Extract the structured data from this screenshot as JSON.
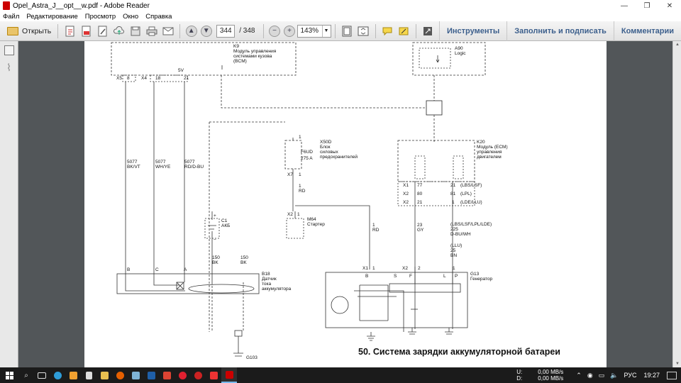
{
  "window": {
    "title": "Opel_Astra_J__opt__w.pdf - Adobe Reader",
    "controls": [
      "—",
      "❐",
      "✕"
    ]
  },
  "menu": [
    "Файл",
    "Редактирование",
    "Просмотр",
    "Окно",
    "Справка"
  ],
  "toolbar": {
    "open_label": "Открыть",
    "page_current": "344",
    "page_total": "/ 348",
    "zoom": "143%",
    "tools_label": "Инструменты",
    "fill_sign_label": "Заполнить и подписать",
    "comments_label": "Комментарии"
  },
  "diagram": {
    "k9": {
      "code": "K9",
      "line1": "Модуль управления",
      "line2": "системами кузова",
      "line3": "(BCM)"
    },
    "k9_pins": {
      "x5": "X5",
      "p8": "8",
      "x4": "X4",
      "p18": "18",
      "p21": "21",
      "v5": "5V"
    },
    "a90": {
      "code": "A90",
      "name": "Logic"
    },
    "x50d": {
      "code": "X50D",
      "line1": "Блок",
      "line2": "силовых",
      "line3": "предохранителей"
    },
    "fuse": {
      "code": "F6UD",
      "rating": "275 A"
    },
    "x7": {
      "conn": "X7",
      "pin": "1"
    },
    "p1_top": "1",
    "rd1": {
      "num": "1",
      "color": "RD"
    },
    "k20": {
      "code": "K20",
      "line1": "Модуль (ECM)",
      "line2": "управления",
      "line3": "двигателем"
    },
    "k20_rows": [
      {
        "conn": "X1",
        "left": "77",
        "right": "21",
        "note": "(LBS/LSF)"
      },
      {
        "conn": "X2",
        "left": "80",
        "right": "81",
        "note": "(LPL)"
      },
      {
        "conn": "X2",
        "left": "21",
        "right": "1",
        "note": "(LDE/LLU)"
      }
    ],
    "wires_bcm": [
      {
        "num": "5077",
        "color": "BK/VT"
      },
      {
        "num": "5077",
        "color": "WH/YE"
      },
      {
        "num": "5077",
        "color": "RD/D-BU"
      }
    ],
    "c1": {
      "code": "C1",
      "name": "АКБ",
      "plus": "+",
      "minus": "−"
    },
    "m64": {
      "conn": "X2",
      "pin": "1",
      "code": "M64",
      "name": "Стартер"
    },
    "rd_starter": {
      "num": "1",
      "color": "RD"
    },
    "gy": {
      "num": "23",
      "color": "GY"
    },
    "gen_wire": {
      "variant": "(LBS/LSF/LPL/LDE)",
      "num": "225",
      "color": "D-BU/WH",
      "variant2": "(LLU)",
      "num2": "25",
      "color2": "BN"
    },
    "bk150a": {
      "num": "150",
      "color": "BK"
    },
    "bk150b": {
      "num": "150",
      "color": "BK"
    },
    "b18": {
      "code": "B18",
      "line1": "Датчик",
      "line2": "тока",
      "line3": "аккумулятора",
      "pins": [
        "B",
        "C",
        "A"
      ]
    },
    "g13": {
      "code": "G13",
      "name": "Генератор",
      "pins": [
        "B",
        "S",
        "F",
        "L",
        "P"
      ],
      "x1": "X1",
      "x1pin": "1",
      "x2": "X2",
      "x2pins": [
        "2",
        "1"
      ]
    },
    "g103": "G103",
    "caption": "50. Система зарядки аккумуляторной батареи"
  },
  "tray": {
    "net_up_label": "U:",
    "net_up": "0,00 MB/s",
    "net_down_label": "D:",
    "net_down": "0,00 MB/s",
    "lang": "РУС",
    "time": "19:27"
  },
  "colors": {
    "accent": "#3c5f8c",
    "taskbar": "#1b1b1b",
    "doc_bg": "#525659"
  }
}
